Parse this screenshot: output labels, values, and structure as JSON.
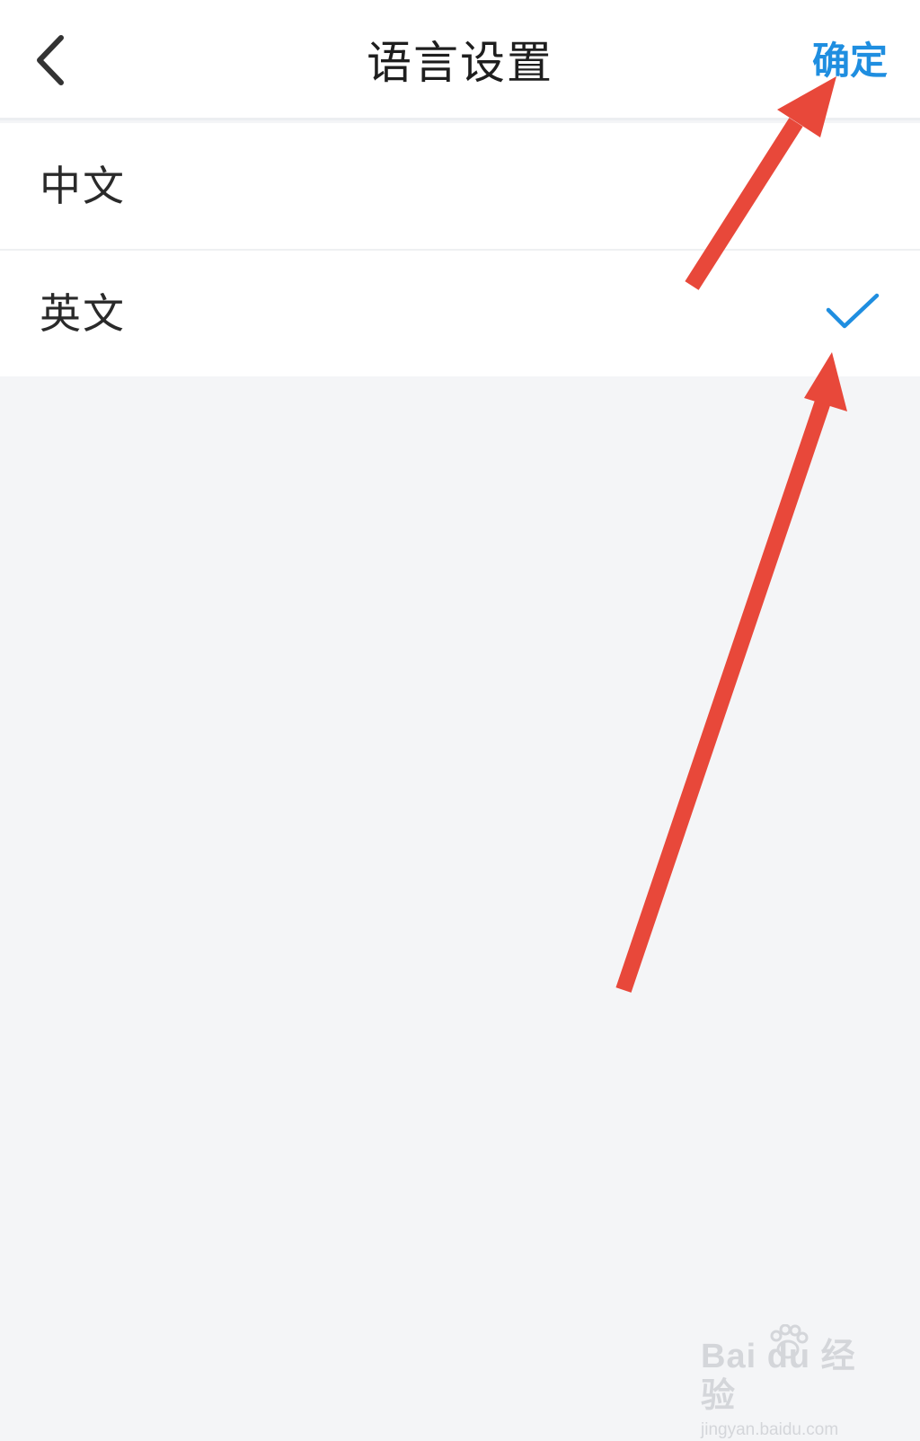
{
  "header": {
    "title": "语言设置",
    "confirm_label": "确定"
  },
  "languages": [
    {
      "label": "中文",
      "selected": false
    },
    {
      "label": "英文",
      "selected": true
    }
  ],
  "colors": {
    "accent": "#1f8ee0",
    "annotation_arrow": "#e8483a",
    "background": "#f4f5f7"
  },
  "icons": {
    "back": "chevron-left-icon",
    "check": "check-icon",
    "paw": "paw-icon"
  },
  "watermark": {
    "main": "Bai du 经验",
    "url": "jingyan.baidu.com"
  }
}
